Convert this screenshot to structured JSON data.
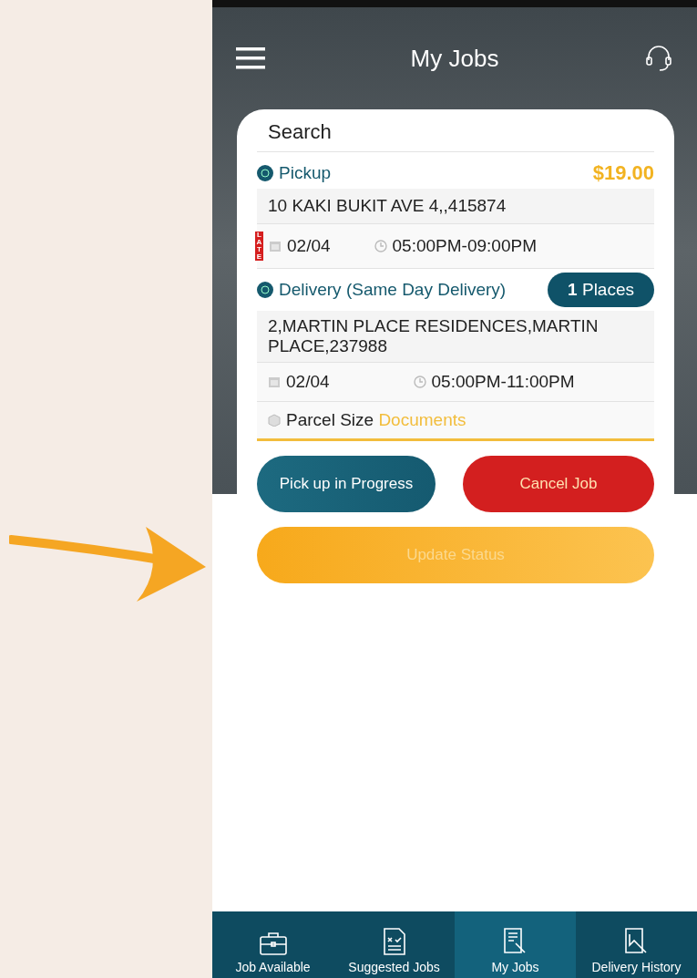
{
  "header": {
    "title": "My Jobs"
  },
  "search": {
    "placeholder": "Search"
  },
  "job": {
    "pickup": {
      "label": "Pickup",
      "price": "$19.00",
      "address": "10 KAKI BUKIT AVE 4,,415874",
      "late_tag": "LATE",
      "date": "02/04",
      "time": "05:00PM-09:00PM"
    },
    "delivery": {
      "label": "Delivery (Same Day Delivery)",
      "places_count": "1",
      "places_label": "Places",
      "address": "2,MARTIN PLACE RESIDENCES,MARTIN PLACE,237988",
      "date": "02/04",
      "time": "05:00PM-11:00PM"
    },
    "parcel": {
      "label": "Parcel Size",
      "value": "Documents"
    }
  },
  "actions": [
    {
      "label": "Pick up in Progress",
      "kind": "progress"
    },
    {
      "label": "Cancel Job",
      "kind": "cancel"
    }
  ],
  "update_button": {
    "label": "Update Status",
    "disabled": true
  },
  "bottom_nav": [
    {
      "label": "Job Available",
      "selected": false
    },
    {
      "label": "Suggested Jobs",
      "selected": false
    },
    {
      "label": "My Jobs",
      "selected": true
    },
    {
      "label": "Delivery History",
      "selected": false
    }
  ]
}
